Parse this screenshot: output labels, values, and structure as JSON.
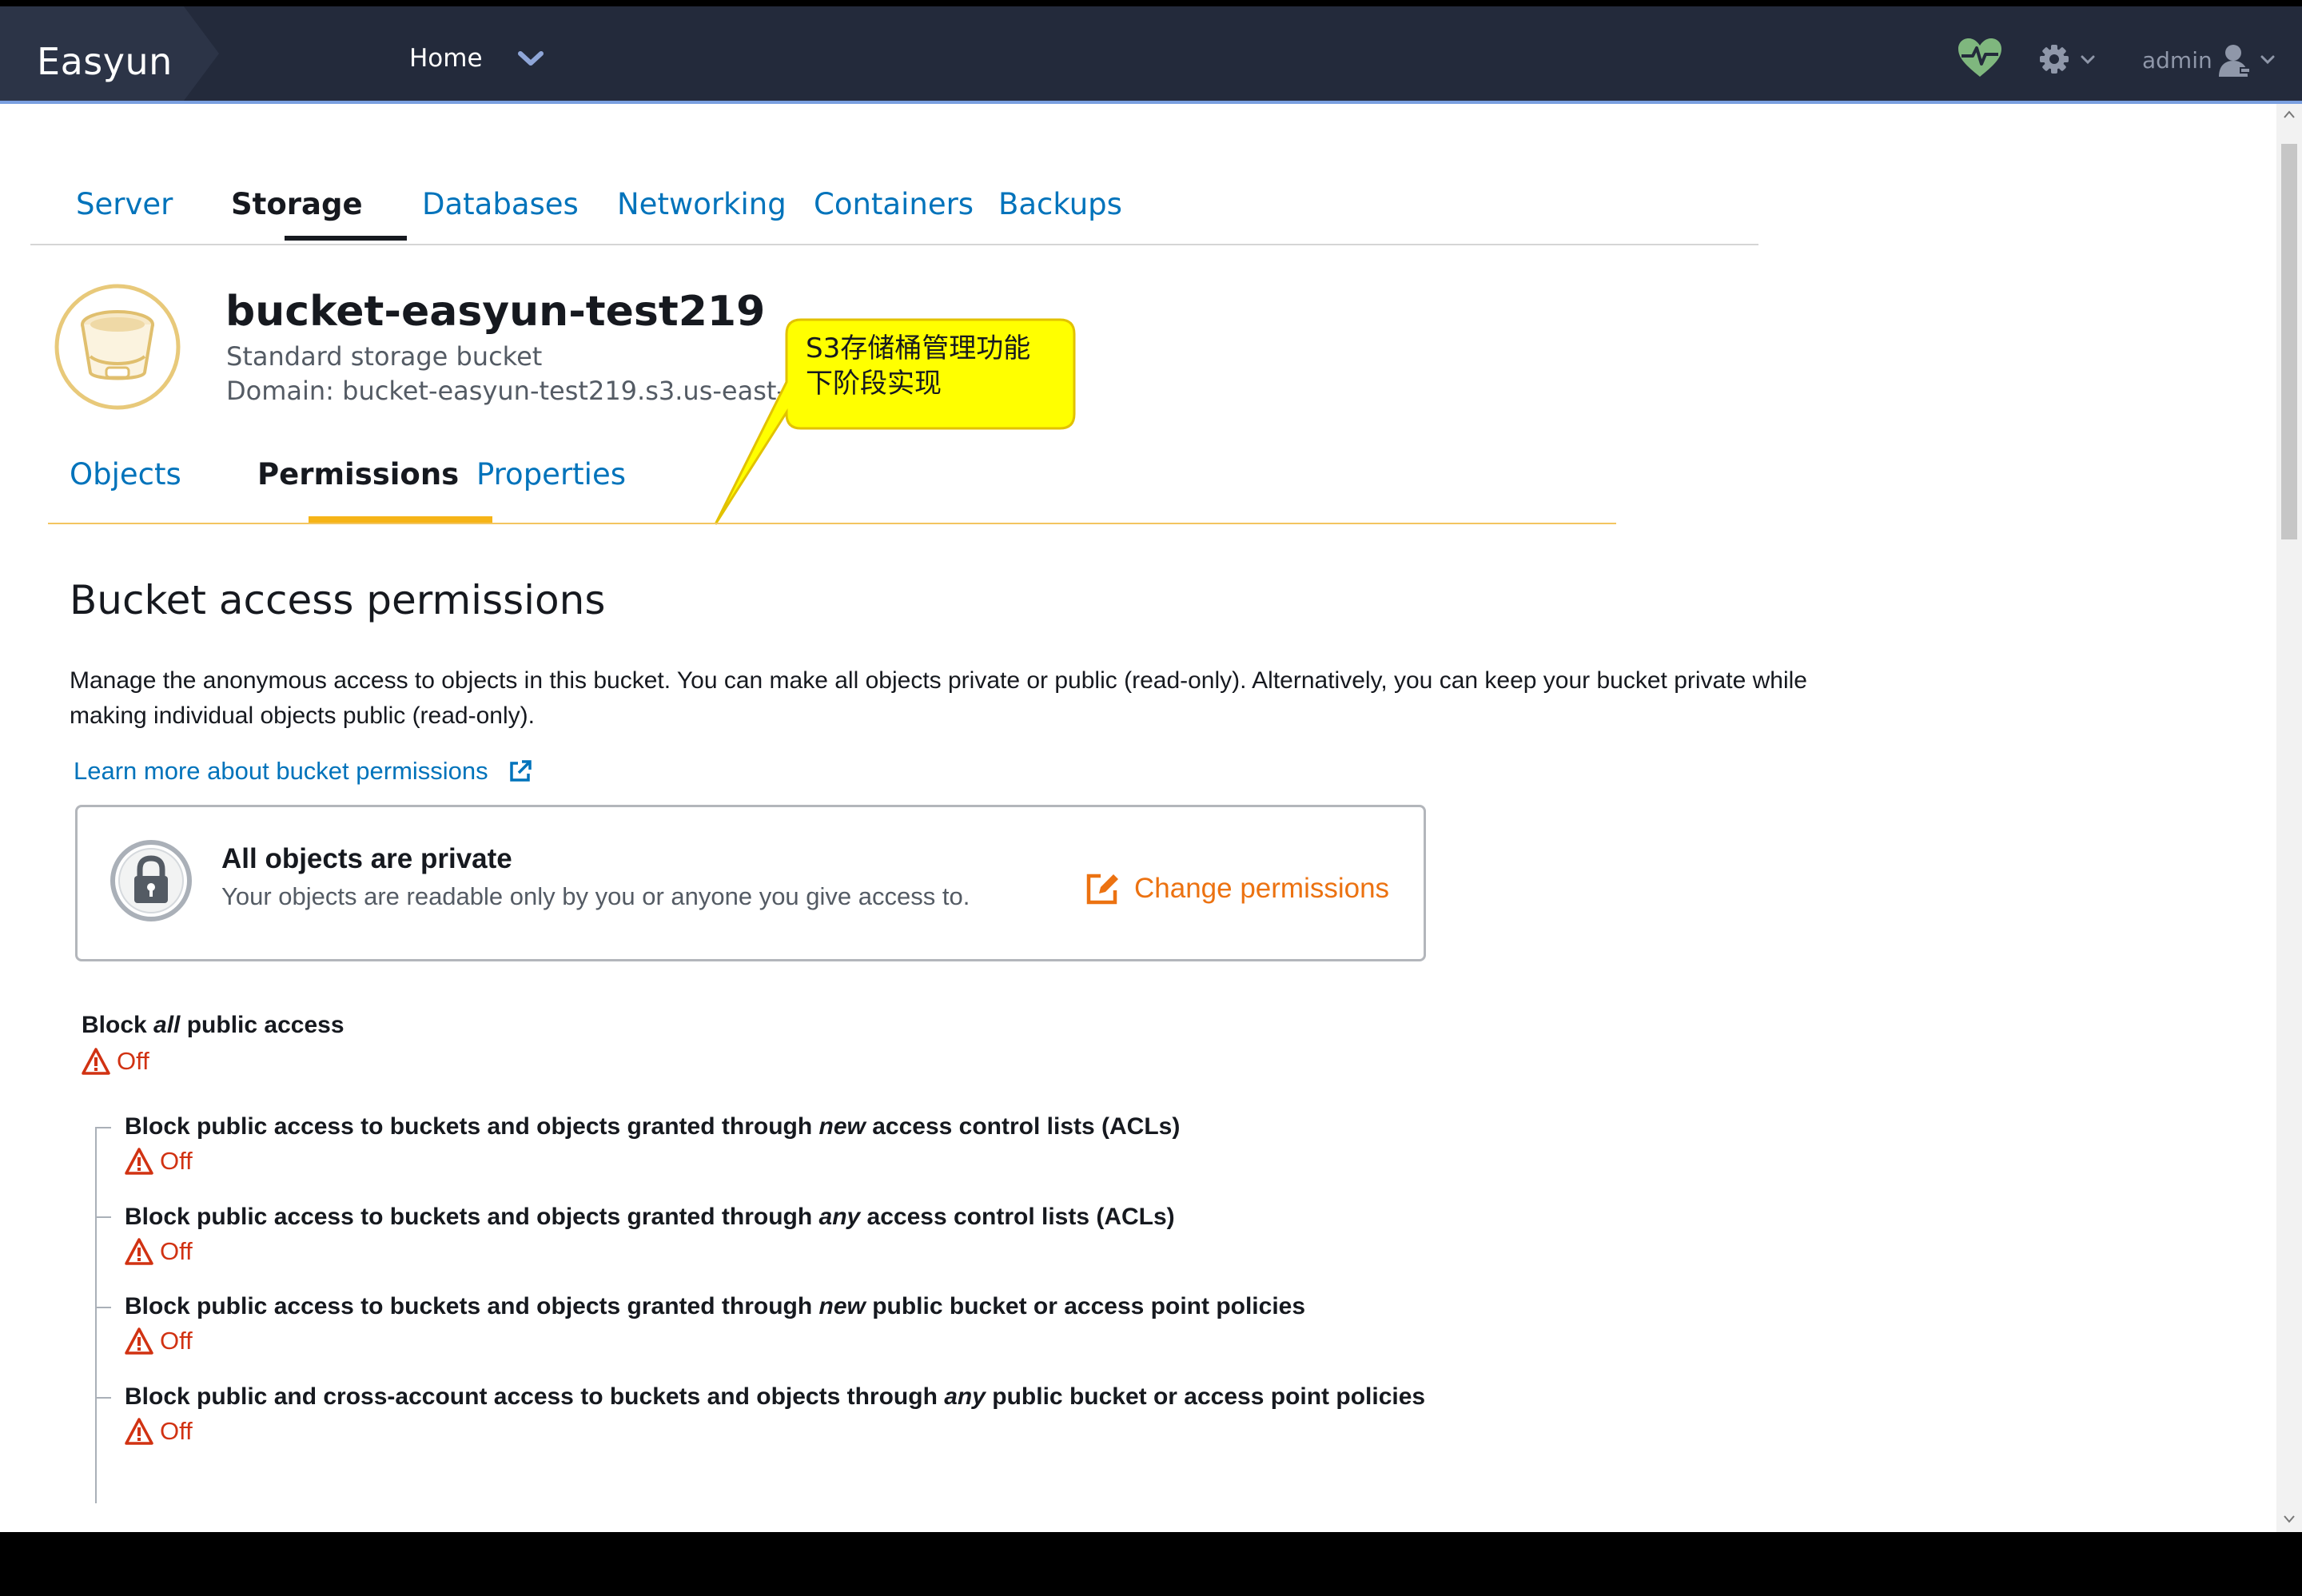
{
  "app": {
    "brand": "Easyun",
    "home_label": "Home",
    "user_label": "admin"
  },
  "main_tabs": [
    {
      "label": "Server",
      "active": false
    },
    {
      "label": "Storage",
      "active": true
    },
    {
      "label": "Databases",
      "active": false
    },
    {
      "label": "Networking",
      "active": false
    },
    {
      "label": "Containers",
      "active": false
    },
    {
      "label": "Backups",
      "active": false
    }
  ],
  "bucket": {
    "name": "bucket-easyun-test219",
    "type": "Standard storage bucket",
    "domain": "Domain: bucket-easyun-test219.s3.us-east-"
  },
  "callout": {
    "text": "S3存储桶管理功能下阶段实现"
  },
  "sub_tabs": [
    {
      "label": "Objects",
      "active": false
    },
    {
      "label": "Permissions",
      "active": true
    },
    {
      "label": "Properties",
      "active": false
    }
  ],
  "permissions": {
    "title": "Bucket access permissions",
    "description": "Manage the anonymous access to objects in this bucket. You can make all objects private or public (read-only). Alternatively, you can keep your bucket private while making individual objects public (read-only).",
    "learn_more": "Learn more about bucket permissions",
    "box_title": "All objects are private",
    "box_subtitle": "Your objects are readable only by you or anyone you give access to.",
    "change_button": "Change permissions",
    "block_all": {
      "prefix": "Block ",
      "emph": "all",
      "suffix": " public access",
      "status": "Off"
    },
    "rules": [
      {
        "prefix": "Block public access to buckets and objects granted through ",
        "emph": "new",
        "suffix": " access control lists (ACLs)",
        "status": "Off"
      },
      {
        "prefix": "Block public access to buckets and objects granted through ",
        "emph": "any",
        "suffix": " access control lists (ACLs)",
        "status": "Off"
      },
      {
        "prefix": "Block public access to buckets and objects granted through ",
        "emph": "new",
        "suffix": " public bucket or access point policies",
        "status": "Off"
      },
      {
        "prefix": "Block public and cross-account access to buckets and objects through ",
        "emph": "any",
        "suffix": " public bucket or access point policies",
        "status": "Off"
      }
    ]
  },
  "colors": {
    "nav_bg": "#232a3b",
    "link": "#0073bb",
    "accent_orange": "#ec7211",
    "tab_accent": "#f6b417",
    "warning": "#d13212",
    "health_green": "#7fb77e"
  },
  "icons": [
    "chevron-down-icon",
    "heartbeat-icon",
    "gear-icon",
    "user-icon",
    "bucket-icon",
    "external-link-icon",
    "lock-icon",
    "edit-icon",
    "warning-icon"
  ]
}
